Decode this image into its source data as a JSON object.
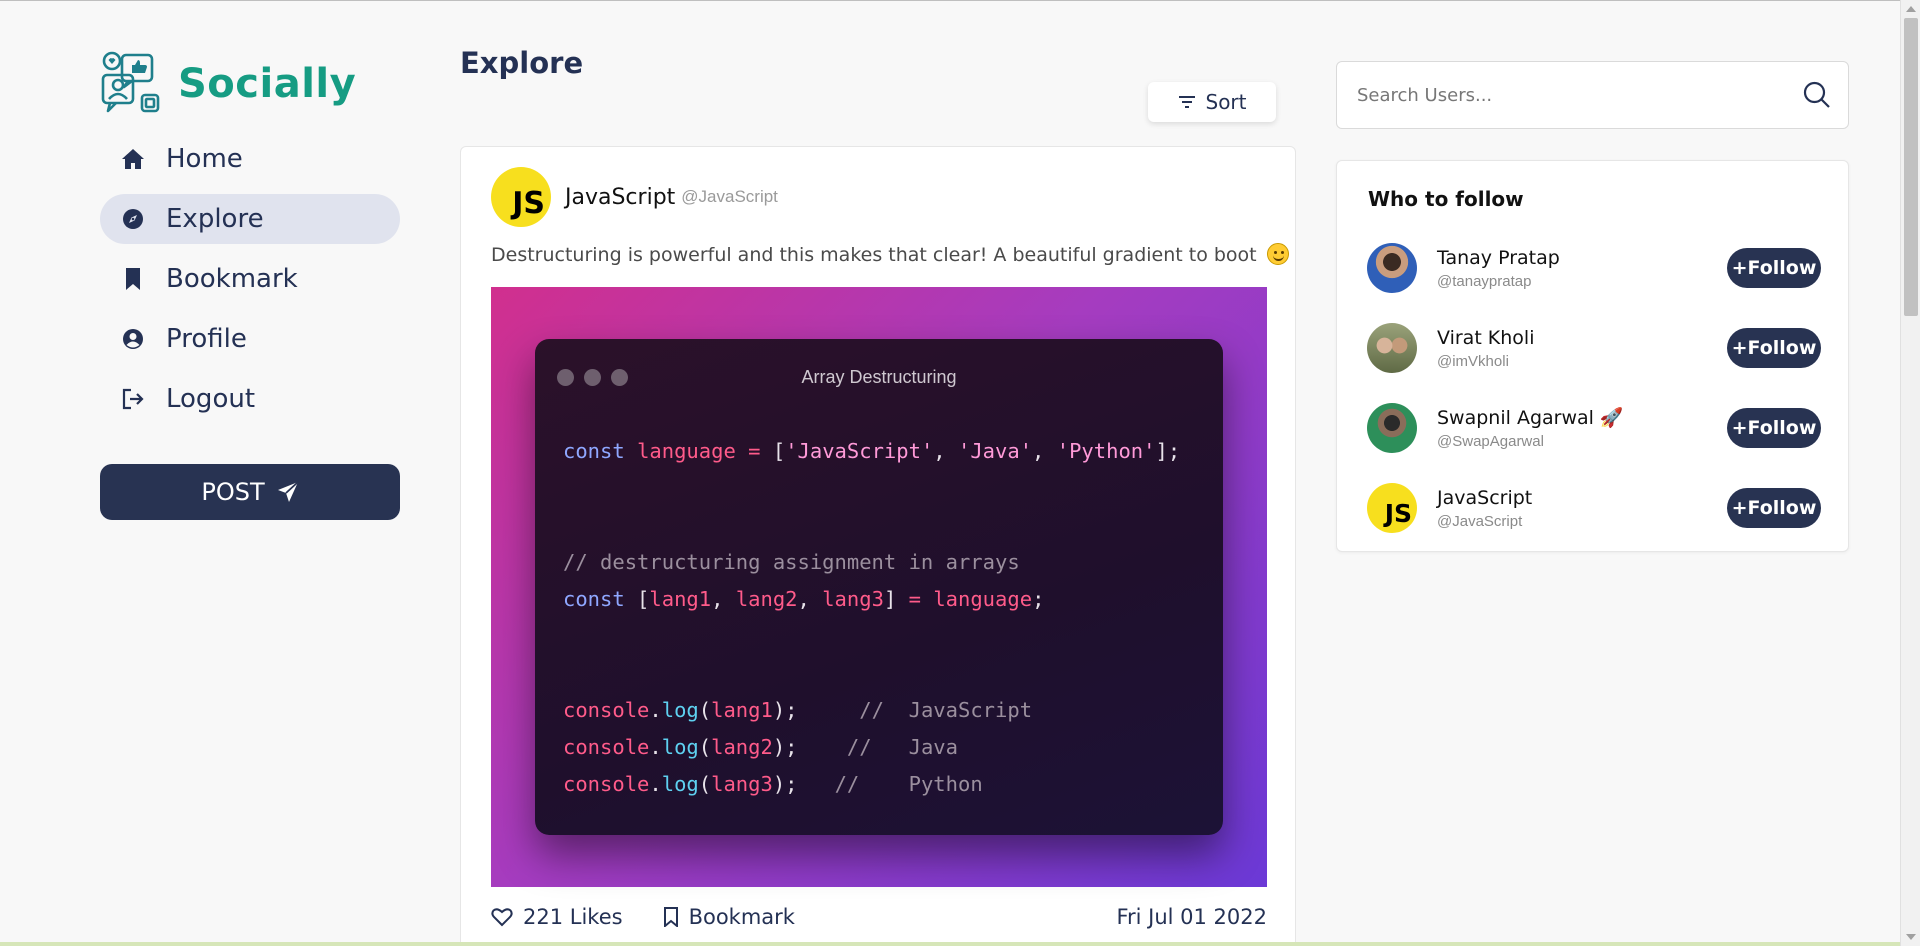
{
  "brand": {
    "name": "Socially"
  },
  "nav": {
    "items": [
      {
        "label": "Home",
        "icon": "home-icon"
      },
      {
        "label": "Explore",
        "icon": "compass-icon",
        "active": true
      },
      {
        "label": "Bookmark",
        "icon": "bookmark-icon"
      },
      {
        "label": "Profile",
        "icon": "user-circle-icon"
      },
      {
        "label": "Logout",
        "icon": "logout-icon"
      }
    ],
    "post_label": "POST"
  },
  "main": {
    "title": "Explore",
    "sort_label": "Sort"
  },
  "post": {
    "avatar_text": "JS",
    "name": "JavaScript",
    "handle": "@JavaScript",
    "text": "Destructuring is powerful and this makes that clear! A beautiful gradient to boot",
    "image": {
      "title": "Array Destructuring",
      "code_lines": [
        "const language = ['JavaScript', 'Java', 'Python'];",
        "",
        "",
        "// destructuring assignment in arrays",
        "const [lang1, lang2, lang3] = language;",
        "",
        "",
        "console.log(lang1);     //  JavaScript",
        "console.log(lang2);    //   Java",
        "console.log(lang3);   //    Python"
      ]
    },
    "likes_label": "221 Likes",
    "bookmark_label": "Bookmark",
    "date": "Fri Jul 01 2022"
  },
  "search": {
    "placeholder": "Search Users..."
  },
  "who_to_follow": {
    "title": "Who to follow",
    "follow_label": "+Follow",
    "users": [
      {
        "name": "Tanay Pratap",
        "handle": "@tanaypratap"
      },
      {
        "name": "Virat Kholi",
        "handle": "@imVkholi"
      },
      {
        "name": "Swapnil Agarwal",
        "handle": "@SwapAgarwal"
      },
      {
        "name": "JavaScript",
        "handle": "@JavaScript",
        "avatar_text": "JS"
      }
    ]
  },
  "colors": {
    "brand": "#169c83",
    "navy": "#283352",
    "active_nav_bg": "#e0e3ee"
  }
}
